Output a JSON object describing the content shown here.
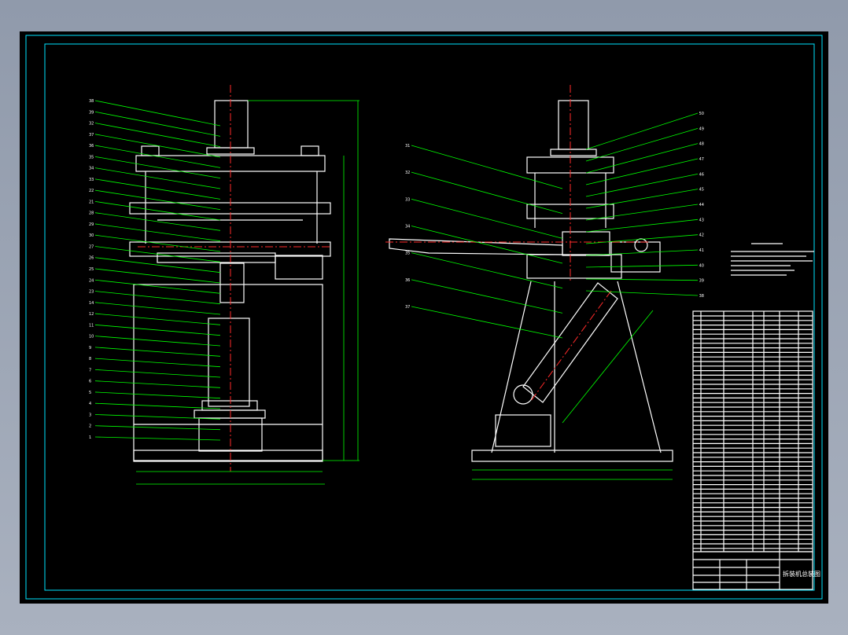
{
  "viewport": {
    "background": "#8d97a8"
  },
  "sheet": {
    "background": "#000000",
    "frame_color": "#00e5ff"
  },
  "colors": {
    "outline": "#ffffff",
    "leader": "#00ff00",
    "centerline": "#ff2a2a",
    "frame": "#00e5ff",
    "detail": "#4a7bff"
  },
  "front_view": {
    "balloons_left": [
      "38",
      "39",
      "32",
      "37",
      "36",
      "35",
      "34",
      "33",
      "22",
      "21",
      "28",
      "29",
      "30",
      "27",
      "26",
      "25",
      "24",
      "23",
      "14",
      "12",
      "11",
      "10",
      "9",
      "8",
      "7",
      "6",
      "5",
      "4",
      "3",
      "2",
      "1"
    ]
  },
  "side_view": {
    "balloons_left": [
      "31",
      "32",
      "33",
      "34",
      "35",
      "36",
      "37"
    ],
    "balloons_right": [
      "50",
      "49",
      "48",
      "47",
      "46",
      "45",
      "44",
      "43",
      "42",
      "41",
      "40",
      "39",
      "38"
    ]
  },
  "title_block": {
    "drawing_name": "拆装机总装图"
  }
}
